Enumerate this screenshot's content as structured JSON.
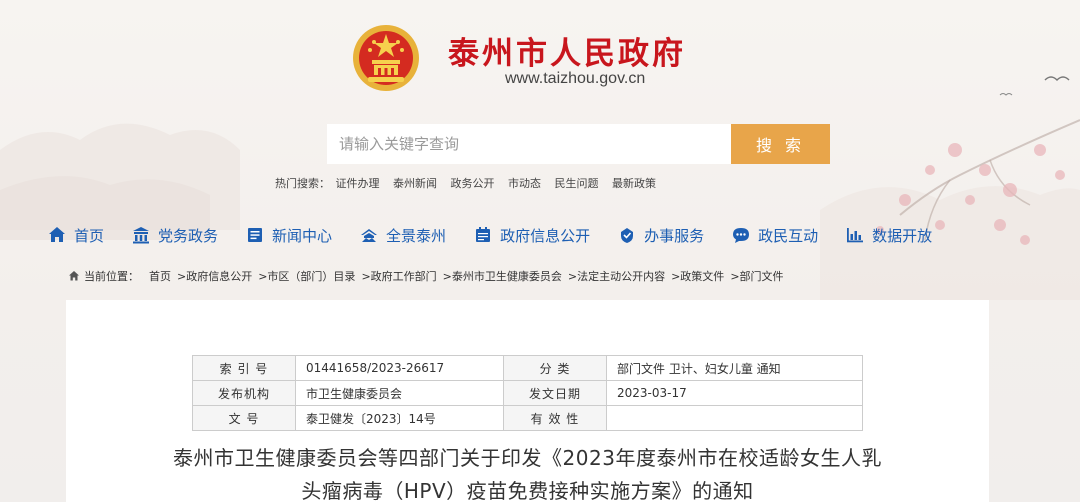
{
  "header": {
    "site_title": "泰州市人民政府",
    "site_url": "www.taizhou.gov.cn"
  },
  "search": {
    "placeholder": "请输入关键字查询",
    "button_label": "搜 索"
  },
  "hot_search": {
    "label": "热门搜索：",
    "items": [
      "证件办理",
      "泰州新闻",
      "政务公开",
      "市动态",
      "民生问题",
      "最新政策"
    ]
  },
  "nav": {
    "items": [
      {
        "label": "首页",
        "icon": "home-icon"
      },
      {
        "label": "党务政务",
        "icon": "building-icon"
      },
      {
        "label": "新闻中心",
        "icon": "newspaper-icon"
      },
      {
        "label": "全景泰州",
        "icon": "landscape-icon"
      },
      {
        "label": "政府信息公开",
        "icon": "calendar-icon"
      },
      {
        "label": "办事服务",
        "icon": "service-icon"
      },
      {
        "label": "政民互动",
        "icon": "chat-icon"
      },
      {
        "label": "数据开放",
        "icon": "bar-chart-icon"
      }
    ]
  },
  "breadcrumb": {
    "label": "当前位置：",
    "items": [
      "首页",
      ">政府信息公开",
      ">市区（部门）目录",
      ">政府工作部门",
      ">泰州市卫生健康委员会",
      ">法定主动公开内容",
      ">政策文件",
      ">部门文件"
    ]
  },
  "meta_table": {
    "rows": [
      {
        "k1": "索 引 号",
        "v1": "01441658/2023-26617",
        "k2": "分 类",
        "v2": "部门文件 卫计、妇女儿童 通知"
      },
      {
        "k1": "发布机构",
        "v1": "市卫生健康委员会",
        "k2": "发文日期",
        "v2": "2023-03-17"
      },
      {
        "k1": "文 号",
        "v1": "泰卫健发〔2023〕14号",
        "k2": "有 效 性",
        "v2": ""
      }
    ]
  },
  "document": {
    "title_line1": "泰州市卫生健康委员会等四部门关于印发《2023年度泰州市在校适龄女生人乳",
    "title_line2": "头瘤病毒（HPV）疫苗免费接种实施方案》的通知"
  },
  "colors": {
    "brand_red": "#c8161d",
    "nav_blue": "#1e5fb3",
    "search_button": "#e8a54a"
  }
}
